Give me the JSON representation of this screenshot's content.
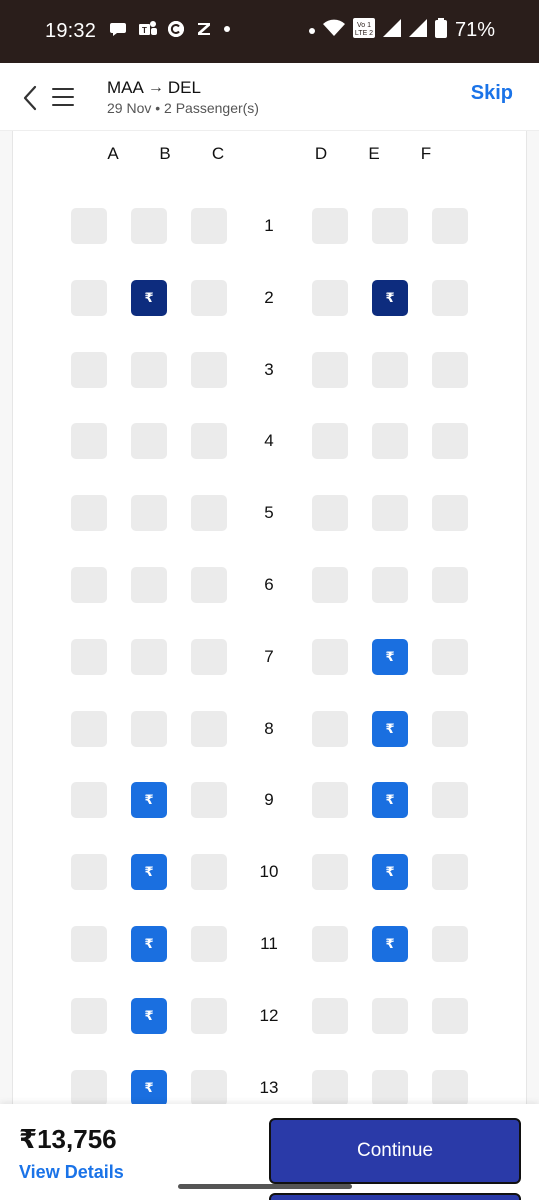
{
  "status_bar": {
    "time": "19:32",
    "left_icons": [
      "chat-bubble-icon",
      "teams-icon",
      "circle-c-icon",
      "z-icon"
    ],
    "battery": "71%"
  },
  "header": {
    "origin": "MAA",
    "destination": "DEL",
    "subline": "29 Nov • 2 Passenger(s)",
    "skip_label": "Skip"
  },
  "seat_map": {
    "columns": [
      "A",
      "B",
      "C",
      "D",
      "E",
      "F"
    ],
    "rows": [
      {
        "number": "1",
        "seats": [
          "",
          "",
          "",
          "",
          "",
          ""
        ]
      },
      {
        "number": "2",
        "seats": [
          "",
          "selected",
          "",
          "",
          "selected",
          ""
        ]
      },
      {
        "number": "3",
        "seats": [
          "",
          "",
          "",
          "",
          "",
          ""
        ]
      },
      {
        "number": "4",
        "seats": [
          "",
          "",
          "",
          "",
          "",
          ""
        ]
      },
      {
        "number": "5",
        "seats": [
          "",
          "",
          "",
          "",
          "",
          ""
        ]
      },
      {
        "number": "6",
        "seats": [
          "",
          "",
          "",
          "",
          "",
          ""
        ]
      },
      {
        "number": "7",
        "seats": [
          "",
          "",
          "",
          "",
          "paid",
          ""
        ]
      },
      {
        "number": "8",
        "seats": [
          "",
          "",
          "",
          "",
          "paid",
          ""
        ]
      },
      {
        "number": "9",
        "seats": [
          "",
          "paid",
          "",
          "",
          "paid",
          ""
        ]
      },
      {
        "number": "10",
        "seats": [
          "",
          "paid",
          "",
          "",
          "paid",
          ""
        ]
      },
      {
        "number": "11",
        "seats": [
          "",
          "paid",
          "",
          "",
          "paid",
          ""
        ]
      },
      {
        "number": "12",
        "seats": [
          "",
          "paid",
          "",
          "",
          "",
          ""
        ]
      },
      {
        "number": "13",
        "seats": [
          "",
          "paid",
          "",
          "",
          "",
          ""
        ]
      }
    ],
    "paid_seat_symbol": "₹",
    "colors": {
      "unavailable": "#ebebeb",
      "paid": "#1a6fe0",
      "selected": "#0d2c7e"
    }
  },
  "footer": {
    "price": "₹13,756",
    "view_details_label": "View Details",
    "continue_label": "Continue"
  }
}
